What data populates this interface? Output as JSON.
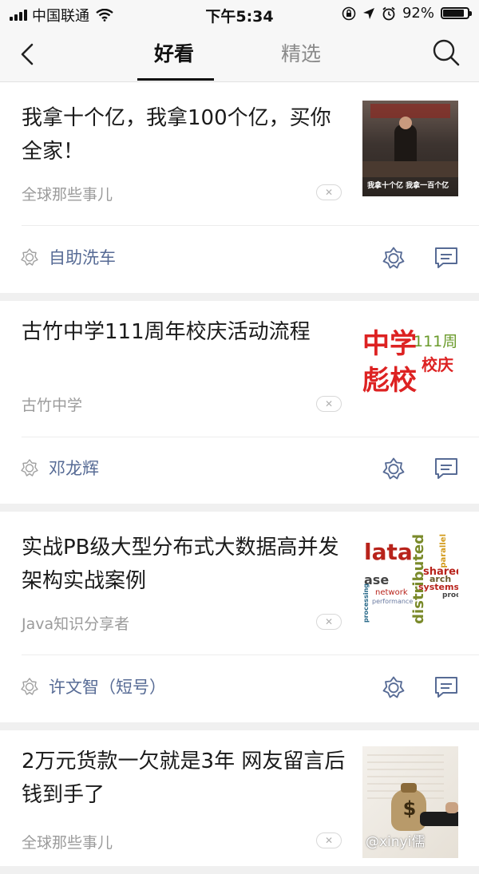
{
  "status_bar": {
    "carrier": "中国联通",
    "time": "下午5:34",
    "battery_percent": "92%",
    "battery_level": 0.92,
    "icons": [
      "signal-icon",
      "wifi-icon",
      "orientation-lock-icon",
      "location-icon",
      "alarm-icon",
      "battery-icon"
    ]
  },
  "nav": {
    "tabs": [
      {
        "label": "好看",
        "active": true
      },
      {
        "label": "精选",
        "active": false
      }
    ],
    "icons": [
      "back-icon",
      "search-icon"
    ]
  },
  "feed": [
    {
      "title": "我拿十个亿，我拿100个亿，买你全家！",
      "source": "全球那些事儿",
      "thumb_caption": "我拿十个亿 我拿一百个亿",
      "friend": "自助洗车"
    },
    {
      "title": "古竹中学111周年校庆活动流程",
      "source": "古竹中学",
      "thumb_text": [
        "中学",
        "彪校",
        "111周",
        "校庆"
      ],
      "friend": "邓龙辉"
    },
    {
      "title": "实战PB级大型分布式大数据高并发架构实战案例",
      "source": "Java知识分享者",
      "thumb_words": [
        "lata",
        "distributed",
        "parallel",
        "shared",
        "ase",
        "network",
        "systems",
        "performance",
        "arch",
        "proce",
        "processing"
      ],
      "friend": "许文智（短号）"
    },
    {
      "title": "2万元货款一欠就是3年 网友留言后钱到手了",
      "source": "全球那些事儿",
      "thumb_symbol": "$"
    }
  ],
  "watermark": "@xinyi儒",
  "colors": {
    "friend_name": "#576b95",
    "source_text": "#9b9b9b",
    "background": "#f0f0f0"
  }
}
